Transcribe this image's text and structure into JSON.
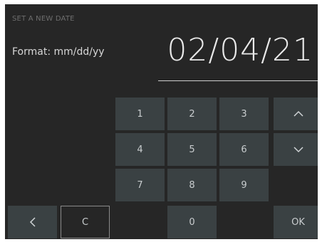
{
  "header": {
    "title": "SET A NEW DATE"
  },
  "format": {
    "label": "Format: mm/dd/yy"
  },
  "date": {
    "value": "02/04/21"
  },
  "keypad": {
    "digits": [
      "1",
      "2",
      "3",
      "4",
      "5",
      "6",
      "7",
      "8",
      "9",
      "0"
    ],
    "clear_label": "C",
    "ok_label": "OK"
  },
  "icons": {
    "up": "chevron-up-icon",
    "down": "chevron-down-icon",
    "back": "chevron-left-icon"
  },
  "colors": {
    "background": "#262626",
    "key": "#3a4143",
    "text": "#c9cdcf"
  }
}
